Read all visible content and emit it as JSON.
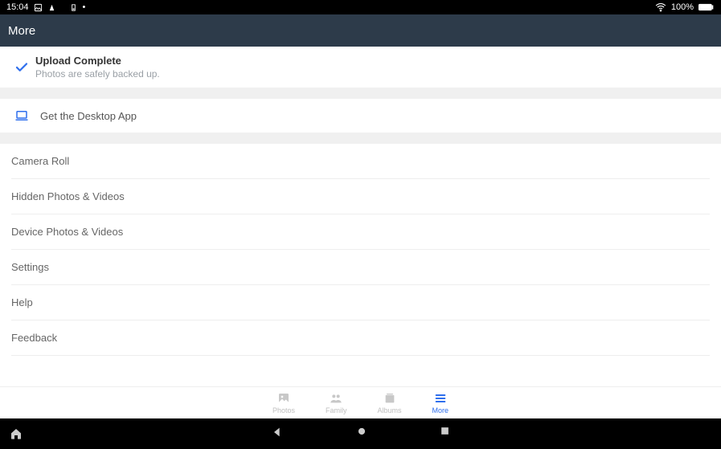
{
  "status": {
    "time": "15:04",
    "battery_pct": "100%"
  },
  "appbar": {
    "title": "More"
  },
  "upload": {
    "title": "Upload Complete",
    "subtitle": "Photos are safely backed up."
  },
  "desktop": {
    "label": "Get the Desktop App"
  },
  "menu": {
    "camera_roll": "Camera Roll",
    "hidden": "Hidden Photos & Videos",
    "device": "Device Photos & Videos",
    "settings": "Settings",
    "help": "Help",
    "feedback": "Feedback"
  },
  "nav": {
    "photos": "Photos",
    "family": "Family",
    "albums": "Albums",
    "more": "More"
  }
}
